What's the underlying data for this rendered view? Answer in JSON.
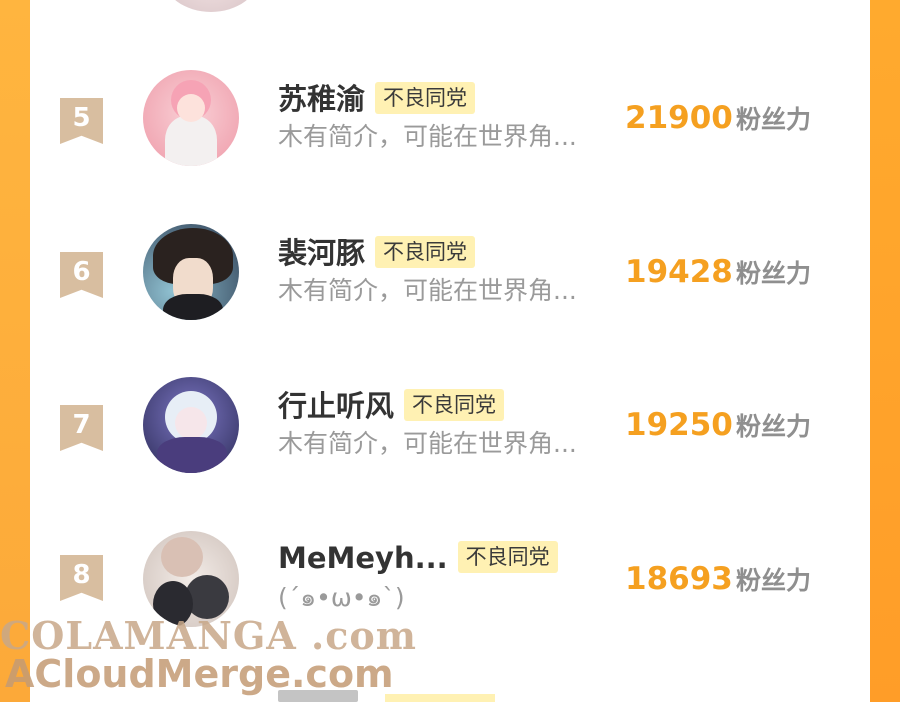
{
  "list": {
    "items": [
      {
        "rank": "5",
        "name": "苏稚渝",
        "tag": "不良同党",
        "bio": "木有简介，可能在世界角...",
        "score": "21900",
        "score_unit": "粉丝力",
        "avatar_icon": "avatar-pink-hair-boy"
      },
      {
        "rank": "6",
        "name": "裴河豚",
        "tag": "不良同党",
        "bio": "木有简介，可能在世界角...",
        "score": "19428",
        "score_unit": "粉丝力",
        "avatar_icon": "avatar-dark-hair-boy"
      },
      {
        "rank": "7",
        "name": "行止听风",
        "tag": "不良同党",
        "bio": "木有简介，可能在世界角...",
        "score": "19250",
        "score_unit": "粉丝力",
        "avatar_icon": "avatar-silver-hair-girl"
      },
      {
        "rank": "8",
        "name": "MeMeyh...",
        "tag": "不良同党",
        "bio": "(´๑•ω•๑`)",
        "score": "18693",
        "score_unit": "粉丝力",
        "avatar_icon": "avatar-two-boys"
      }
    ]
  },
  "watermark": {
    "line1": "COLAMANGA .com",
    "line2": "ACloudMerge.com"
  },
  "colors": {
    "accent": "#f5a020",
    "side_bar": "#ffa42b",
    "tag_bg": "#fff1b3",
    "rank_badge": "#d8bea0"
  }
}
